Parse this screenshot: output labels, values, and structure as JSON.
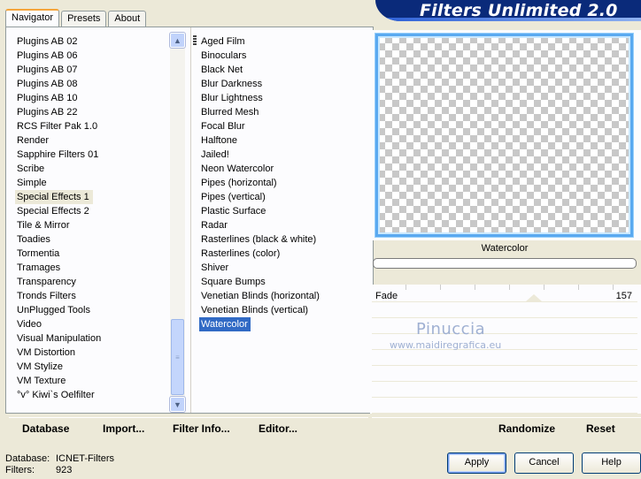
{
  "title": "Filters Unlimited 2.0",
  "tabs": [
    "Navigator",
    "Presets",
    "About"
  ],
  "categories": [
    "Plugins AB 02",
    "Plugins AB 06",
    "Plugins AB 07",
    "Plugins AB 08",
    "Plugins AB 10",
    "Plugins AB 22",
    "RCS Filter Pak 1.0",
    "Render",
    "Sapphire Filters 01",
    "Scribe",
    "Simple",
    "Special Effects 1",
    "Special Effects 2",
    "Tile & Mirror",
    "Toadies",
    "Tormentia",
    "Tramages",
    "Transparency",
    "Tronds Filters",
    "UnPlugged Tools",
    "Video",
    "Visual Manipulation",
    "VM Distortion",
    "VM Stylize",
    "VM Texture",
    "°v° Kiwi`s Oelfilter"
  ],
  "selected_category": "Special Effects 1",
  "filters": [
    "Aged Film",
    "Binoculars",
    "Black Net",
    "Blur Darkness",
    "Blur Lightness",
    "Blurred Mesh",
    "Focal Blur",
    "Halftone",
    "Jailed!",
    "Neon Watercolor",
    "Pipes (horizontal)",
    "Pipes (vertical)",
    "Plastic Surface",
    "Radar",
    "Rasterlines (black & white)",
    "Rasterlines (color)",
    "Shiver",
    "Square Bumps",
    "Venetian Blinds (horizontal)",
    "Venetian Blinds (vertical)",
    "Watercolor"
  ],
  "selected_filter": "Watercolor",
  "left_buttons": {
    "database": "Database",
    "import": "Import...",
    "filter_info": "Filter Info...",
    "editor": "Editor..."
  },
  "preview": {
    "filter_name": "Watercolor",
    "progress": 0
  },
  "parameters": [
    {
      "label": "Fade",
      "value": "157"
    }
  ],
  "watermark": {
    "name": "Pinuccia",
    "url": "www.maidiregrafica.eu"
  },
  "right_buttons": {
    "randomize": "Randomize",
    "reset": "Reset"
  },
  "status": {
    "database_label": "Database:",
    "database_value": "ICNET-Filters",
    "filters_label": "Filters:",
    "filters_value": "923"
  },
  "dialog_buttons": {
    "apply": "Apply",
    "cancel": "Cancel",
    "help": "Help"
  }
}
